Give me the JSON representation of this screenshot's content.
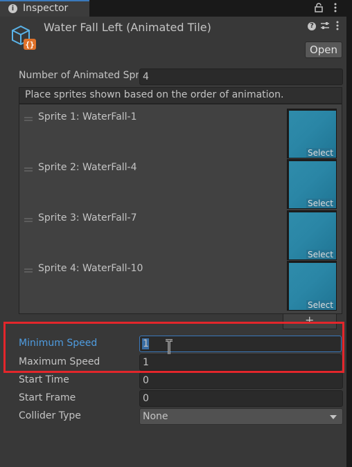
{
  "tab": {
    "label": "Inspector",
    "icon": "info-icon"
  },
  "window_icons": {
    "lock": "lock-icon",
    "menu": "kebab-menu-icon"
  },
  "asset": {
    "title": "Water Fall Left (Animated Tile)",
    "icon": "tile-asset-icon",
    "open_label": "Open",
    "help_icon": "help-icon",
    "settings_icon": "presets-icon",
    "menu_icon": "kebab-menu-icon"
  },
  "count": {
    "label": "Number of Animated Sprites",
    "value": "4"
  },
  "list": {
    "header": "Place sprites shown based on the order of animation.",
    "items": [
      {
        "label": "Sprite 1: WaterFall-1",
        "select": "Select"
      },
      {
        "label": "Sprite 2: WaterFall-4",
        "select": "Select"
      },
      {
        "label": "Sprite 3: WaterFall-7",
        "select": "Select"
      },
      {
        "label": "Sprite 4: WaterFall-10",
        "select": "Select"
      }
    ],
    "add_label": "+"
  },
  "fields": {
    "min_speed": {
      "label": "Minimum Speed",
      "value": "1"
    },
    "max_speed": {
      "label": "Maximum Speed",
      "value": "1"
    },
    "start_time": {
      "label": "Start Time",
      "value": "0"
    },
    "start_frame": {
      "label": "Start Frame",
      "value": "0"
    },
    "collider_type": {
      "label": "Collider Type",
      "value": "None"
    }
  },
  "colors": {
    "highlight": "#e3262b",
    "focus_label": "#4f9ce0",
    "thumb": "#2f8cab"
  }
}
